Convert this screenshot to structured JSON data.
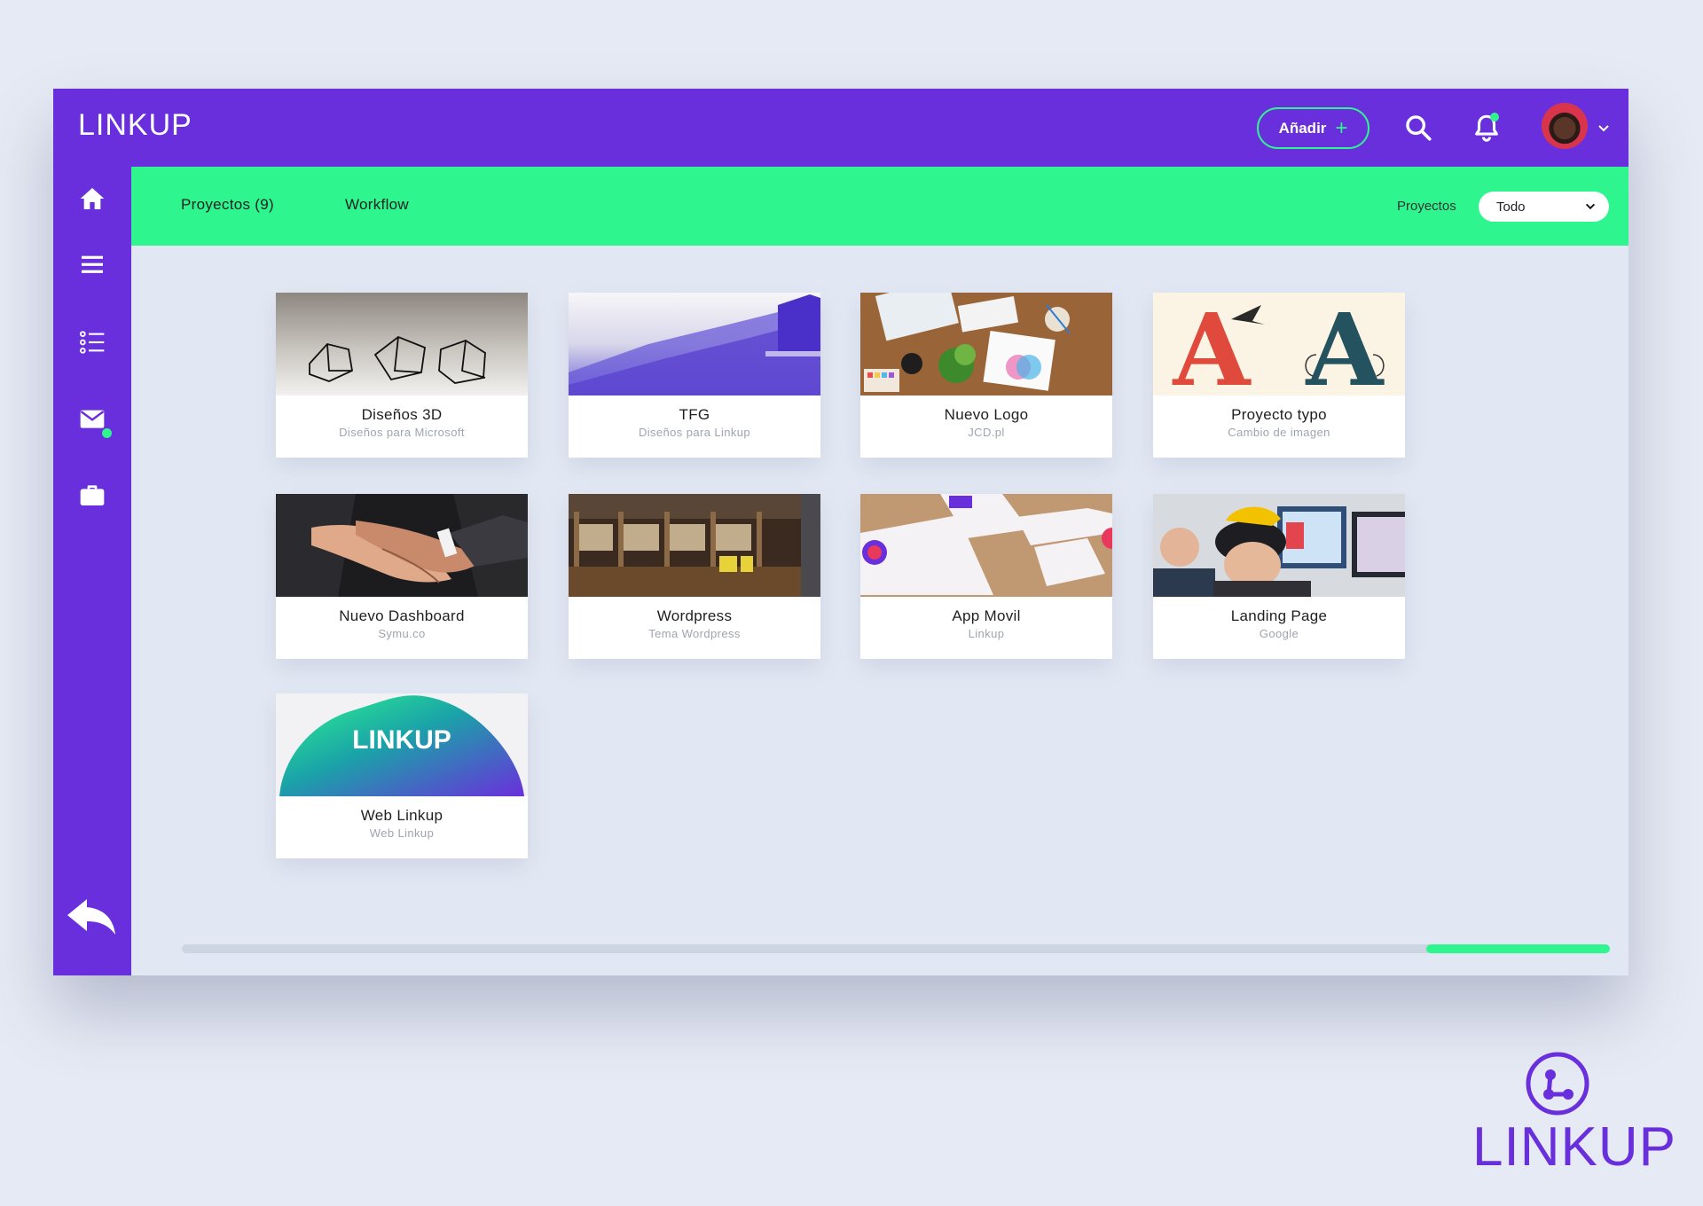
{
  "app": {
    "logo": "LINKUP"
  },
  "header": {
    "add_label": "Añadir",
    "add_plus": "+"
  },
  "subbar": {
    "tabs": [
      "Proyectos (9)",
      "Workflow"
    ],
    "filter_label": "Proyectos",
    "filter_value": "Todo"
  },
  "projects": [
    {
      "title": "Diseños 3D",
      "subtitle": "Diseños para Microsoft"
    },
    {
      "title": "TFG",
      "subtitle": "Diseños para Linkup"
    },
    {
      "title": "Nuevo Logo",
      "subtitle": "JCD.pl"
    },
    {
      "title": "Proyecto typo",
      "subtitle": "Cambio de imagen"
    },
    {
      "title": "Nuevo Dashboard",
      "subtitle": "Symu.co"
    },
    {
      "title": "Wordpress",
      "subtitle": "Tema Wordpress"
    },
    {
      "title": "App Movil",
      "subtitle": "Linkup"
    },
    {
      "title": "Landing Page",
      "subtitle": "Google"
    },
    {
      "title": "Web Linkup",
      "subtitle": "Web Linkup",
      "thumb_text": "LINKUP"
    }
  ],
  "thumb_text_typo": "A",
  "scroll": {
    "position": 0.87
  },
  "brand": {
    "text": "LINKUP"
  },
  "colors": {
    "primary": "#6a2fdc",
    "accent": "#2ef58e",
    "background": "#e2e8f3"
  },
  "icons": [
    "search-icon",
    "bell-icon",
    "chevron-down-icon",
    "home-icon",
    "menu-icon",
    "list-icon",
    "mail-icon",
    "briefcase-icon",
    "reply-icon"
  ]
}
